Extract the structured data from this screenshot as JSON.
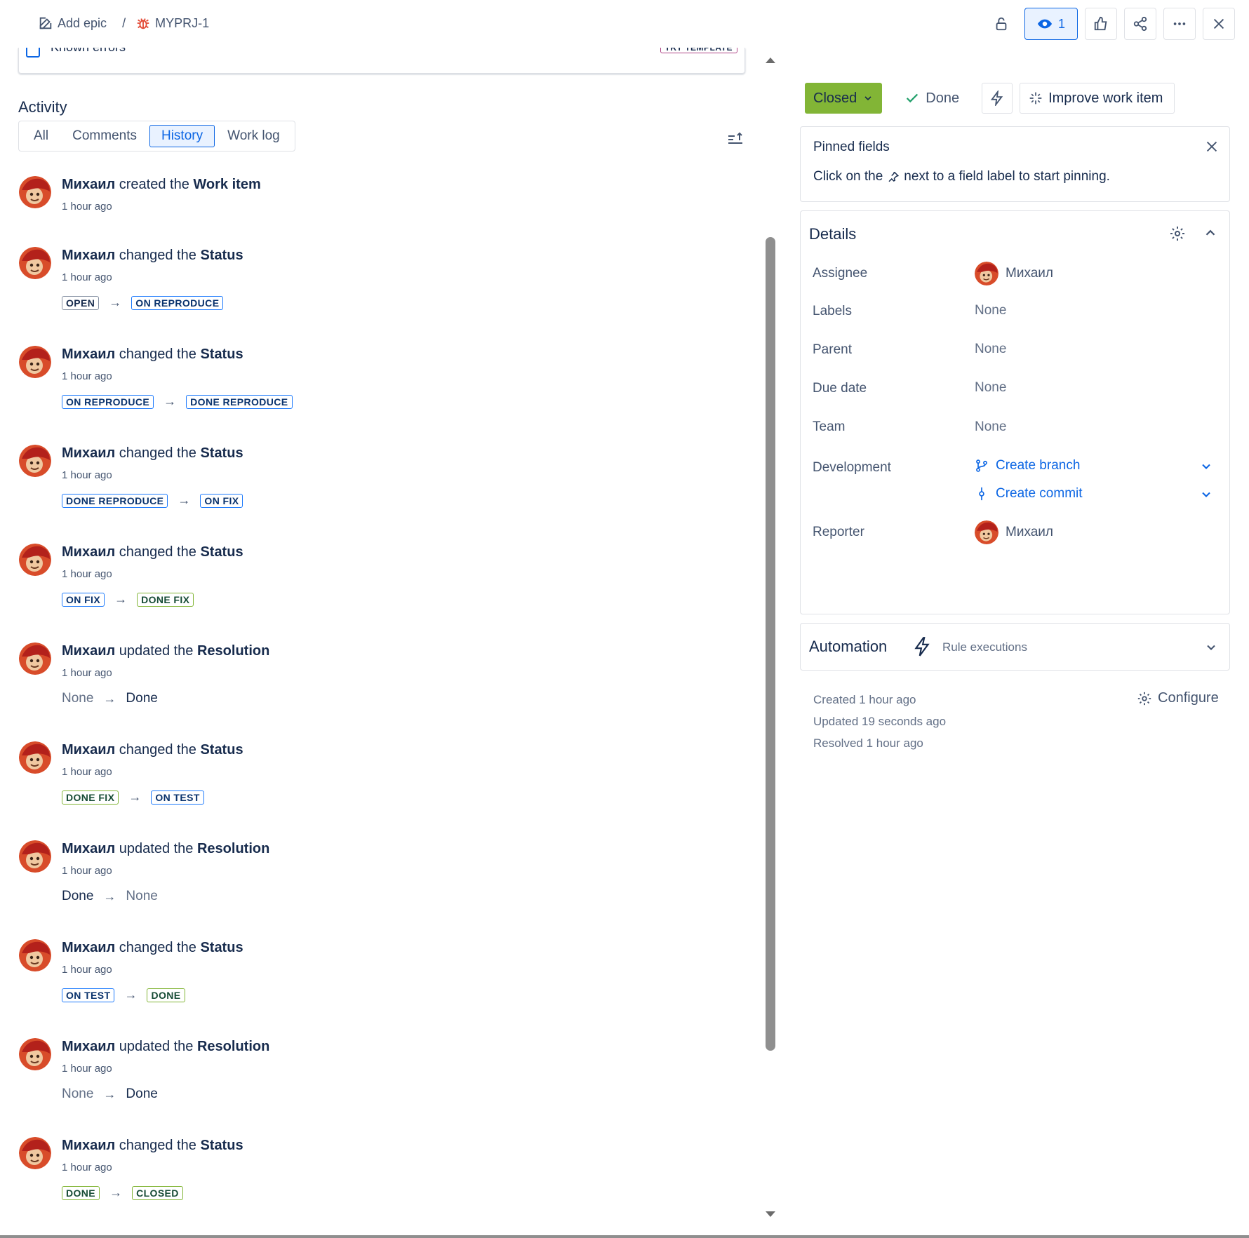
{
  "breadcrumb": {
    "add_epic": "Add epic",
    "separator": "/",
    "issue_key": "MYPRJ-1"
  },
  "toolbar": {
    "watch_count": "1",
    "icons": [
      "lock-icon",
      "eye-icon",
      "like-icon",
      "share-icon",
      "more-icon",
      "close-icon"
    ]
  },
  "known_errors": {
    "label": "Known errors",
    "tag": "TRY TEMPLATE"
  },
  "activity": {
    "title": "Activity",
    "tabs": [
      "All",
      "Comments",
      "History",
      "Work log"
    ],
    "active_tab": "History"
  },
  "history": [
    {
      "user": "Михаил",
      "verb": "created the",
      "field": "Work item",
      "time": "1 hour ago"
    },
    {
      "user": "Михаил",
      "verb": "changed the",
      "field": "Status",
      "time": "1 hour ago",
      "from": "OPEN",
      "to": "ON REPRODUCE",
      "from_style": "grey",
      "to_style": "blue"
    },
    {
      "user": "Михаил",
      "verb": "changed the",
      "field": "Status",
      "time": "1 hour ago",
      "from": "ON REPRODUCE",
      "to": "DONE REPRODUCE",
      "from_style": "blue",
      "to_style": "blue"
    },
    {
      "user": "Михаил",
      "verb": "changed the",
      "field": "Status",
      "time": "1 hour ago",
      "from": "DONE REPRODUCE",
      "to": "ON FIX",
      "from_style": "blue",
      "to_style": "blue"
    },
    {
      "user": "Михаил",
      "verb": "changed the",
      "field": "Status",
      "time": "1 hour ago",
      "from": "ON FIX",
      "to": "DONE FIX",
      "from_style": "blue",
      "to_style": "green"
    },
    {
      "user": "Михаил",
      "verb": "updated the",
      "field": "Resolution",
      "time": "1 hour ago",
      "from_text": "None",
      "to_text": "Done"
    },
    {
      "user": "Михаил",
      "verb": "changed the",
      "field": "Status",
      "time": "1 hour ago",
      "from": "DONE FIX",
      "to": "ON TEST",
      "from_style": "green",
      "to_style": "blue"
    },
    {
      "user": "Михаил",
      "verb": "updated the",
      "field": "Resolution",
      "time": "1 hour ago",
      "from_text": "Done",
      "to_text": "None"
    },
    {
      "user": "Михаил",
      "verb": "changed the",
      "field": "Status",
      "time": "1 hour ago",
      "from": "ON TEST",
      "to": "DONE",
      "from_style": "blue",
      "to_style": "green"
    },
    {
      "user": "Михаил",
      "verb": "updated the",
      "field": "Resolution",
      "time": "1 hour ago",
      "from_text": "None",
      "to_text": "Done"
    },
    {
      "user": "Михаил",
      "verb": "changed the",
      "field": "Status",
      "time": "1 hour ago",
      "from": "DONE",
      "to": "CLOSED",
      "from_style": "green",
      "to_style": "green"
    }
  ],
  "status_bar": {
    "status": "Closed",
    "resolution": "Done",
    "improve": "Improve work item"
  },
  "pinned": {
    "title": "Pinned fields",
    "hint_before": "Click on the",
    "hint_after": "next to a field label to start pinning."
  },
  "details": {
    "title": "Details",
    "assignee_label": "Assignee",
    "assignee": "Михаил",
    "labels_label": "Labels",
    "labels": "None",
    "parent_label": "Parent",
    "parent": "None",
    "due_label": "Due date",
    "due": "None",
    "team_label": "Team",
    "team": "None",
    "development_label": "Development",
    "create_branch": "Create branch",
    "create_commit": "Create commit",
    "reporter_label": "Reporter",
    "reporter": "Михаил"
  },
  "automation": {
    "title": "Automation",
    "subtitle": "Rule executions"
  },
  "meta": {
    "created": "Created 1 hour ago",
    "updated": "Updated 19 seconds ago",
    "resolved": "Resolved 1 hour ago",
    "configure": "Configure"
  },
  "colors": {
    "accent": "#0c66e4",
    "closed_status": "#82b536",
    "text": "#172b4d",
    "subtle": "#44546f"
  }
}
